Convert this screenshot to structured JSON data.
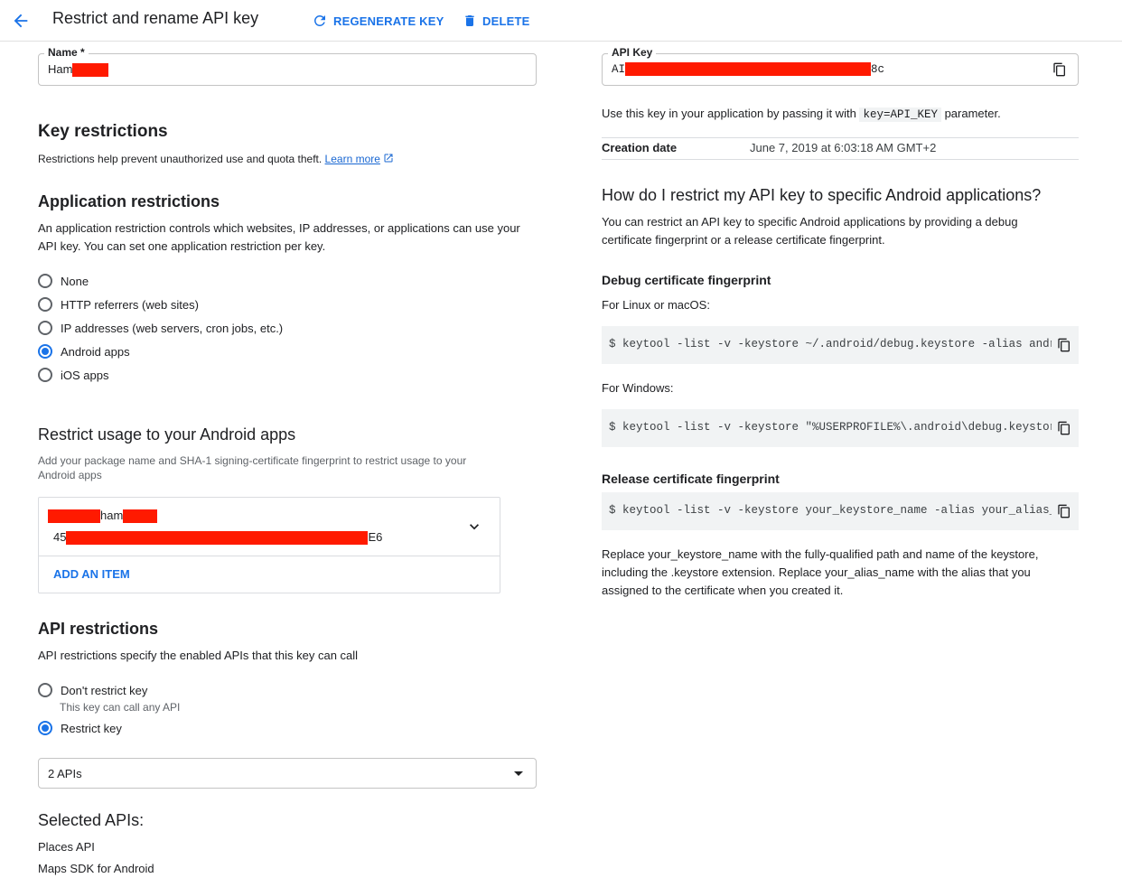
{
  "header": {
    "title": "Restrict and rename API key",
    "regenerate_label": "REGENERATE KEY",
    "delete_label": "DELETE"
  },
  "name_field": {
    "label": "Name *",
    "value_prefix": "Ham"
  },
  "key_restrictions": {
    "heading": "Key restrictions",
    "description": "Restrictions help prevent unauthorized use and quota theft.",
    "learn_more": "Learn more"
  },
  "application_restrictions": {
    "heading": "Application restrictions",
    "description_line1": "An application restriction controls which websites, IP addresses, or applications can use your",
    "description_line2": "API key. You can set one application restriction per key.",
    "options": [
      {
        "label": "None",
        "selected": false
      },
      {
        "label": "HTTP referrers (web sites)",
        "selected": false
      },
      {
        "label": "IP addresses (web servers, cron jobs, etc.)",
        "selected": false
      },
      {
        "label": "Android apps",
        "selected": true
      },
      {
        "label": "iOS apps",
        "selected": false
      }
    ]
  },
  "android_apps": {
    "heading": "Restrict usage to your Android apps",
    "description_line1": "Add your package name and SHA-1 signing-certificate fingerprint to restrict usage to your",
    "description_line2": "Android apps",
    "item": {
      "package_middle": "ham",
      "fingerprint_prefix": "45",
      "fingerprint_suffix": "E6"
    },
    "add_item": "ADD AN ITEM"
  },
  "api_restrictions": {
    "heading": "API restrictions",
    "description": "API restrictions specify the enabled APIs that this key can call",
    "dont_restrict": {
      "label": "Don't restrict key",
      "hint": "This key can call any API",
      "selected": false
    },
    "restrict": {
      "label": "Restrict key",
      "selected": true
    },
    "select_value": "2 APIs"
  },
  "selected_apis": {
    "heading": "Selected APIs:",
    "items": [
      "Places API",
      "Maps SDK for Android"
    ]
  },
  "api_key": {
    "label": "API Key",
    "value_prefix": "AI",
    "value_suffix": "8c",
    "usage_before": "Use this key in your application by passing it with",
    "usage_code": "key=API_KEY",
    "usage_after": "parameter.",
    "creation_label": "Creation date",
    "creation_value": "June 7, 2019 at 6:03:18 AM GMT+2"
  },
  "help": {
    "heading": "How do I restrict my API key to specific Android applications?",
    "intro_line1": "You can restrict an API key to specific Android applications by providing a debug",
    "intro_line2": "certificate fingerprint or a release certificate fingerprint.",
    "debug_heading": "Debug certificate fingerprint",
    "linux_label": "For Linux or macOS:",
    "linux_cmd": "$ keytool -list -v -keystore ~/.android/debug.keystore -alias androi",
    "windows_label": "For Windows:",
    "windows_cmd": "$ keytool -list -v -keystore \"%USERPROFILE%\\.android\\debug.keystore\"",
    "release_heading": "Release certificate fingerprint",
    "release_cmd": "$ keytool -list -v -keystore your_keystore_name -alias your_alias_na",
    "note_line1": "Replace your_keystore_name with the fully-qualified path and name of the keystore,",
    "note_line2": "including the .keystore extension. Replace your_alias_name with the alias that you",
    "note_line3": "assigned to the certificate when you created it."
  },
  "colors": {
    "accent": "#1a73e8",
    "redaction": "#ff1a00",
    "code_bg": "#f1f3f4"
  },
  "icons": {
    "back": "arrow-back-icon",
    "regenerate": "refresh-icon",
    "delete": "trash-icon",
    "external": "external-link-icon",
    "expand": "chevron-down-icon",
    "copy": "copy-icon",
    "dropdown": "caret-down-icon"
  }
}
